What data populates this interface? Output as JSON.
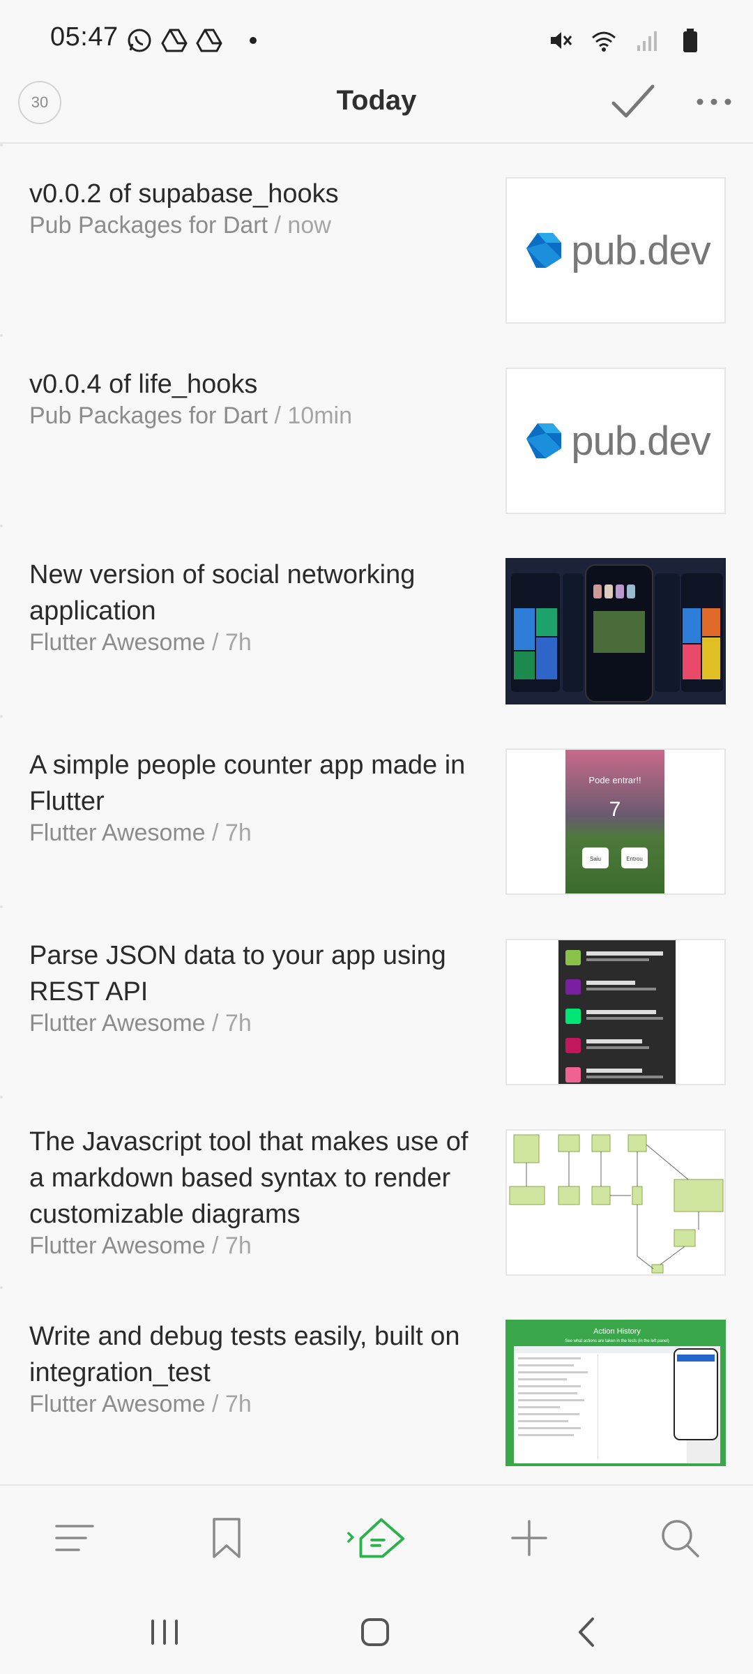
{
  "status_bar": {
    "time": "05:47",
    "left_icons": [
      "whatsapp-icon",
      "drive-icon",
      "drive-icon",
      "dot"
    ],
    "right_icons": [
      "mute-icon",
      "wifi-icon",
      "signal-icon",
      "battery-icon"
    ]
  },
  "header": {
    "counter": "30",
    "title": "Today"
  },
  "feed": [
    {
      "title": "v0.0.2 of supabase_hooks",
      "source": "Pub Packages for Dart",
      "time": "now",
      "thumb": "pubdev"
    },
    {
      "title": "v0.0.4 of life_hooks",
      "source": "Pub Packages for Dart",
      "time": "10min",
      "thumb": "pubdev"
    },
    {
      "title": "New version of social networking application",
      "source": "Flutter Awesome",
      "time": "7h",
      "thumb": "social"
    },
    {
      "title": "A simple people counter app made in Flutter",
      "source": "Flutter Awesome",
      "time": "7h",
      "thumb": "counter"
    },
    {
      "title": "Parse JSON data to your app using REST API",
      "source": "Flutter Awesome",
      "time": "7h",
      "thumb": "json"
    },
    {
      "title": "The Javascript tool that makes use of a markdown based syntax to render customizable diagrams",
      "source": "Flutter Awesome",
      "time": "7h",
      "thumb": "diagram"
    },
    {
      "title": "Write and debug tests easily, built on integration_test",
      "source": "Flutter Awesome",
      "time": "7h",
      "thumb": "action-history"
    }
  ],
  "thumb_text": {
    "pubdev": "pub.dev",
    "counter_heading": "Pode entrar!!",
    "counter_value": "7",
    "counter_btn1": "Saiu",
    "counter_btn2": "Entrou",
    "action_title": "Action History",
    "action_subtitle": "See what actions are taken in the tests (in the left panel)"
  },
  "bottom_nav": [
    "menu-icon",
    "bookmark-icon",
    "feedly-icon",
    "add-icon",
    "search-icon"
  ],
  "colors": {
    "accent": "#2bb24c",
    "text": "#2a2a2a",
    "meta": "#8c8c8c"
  }
}
